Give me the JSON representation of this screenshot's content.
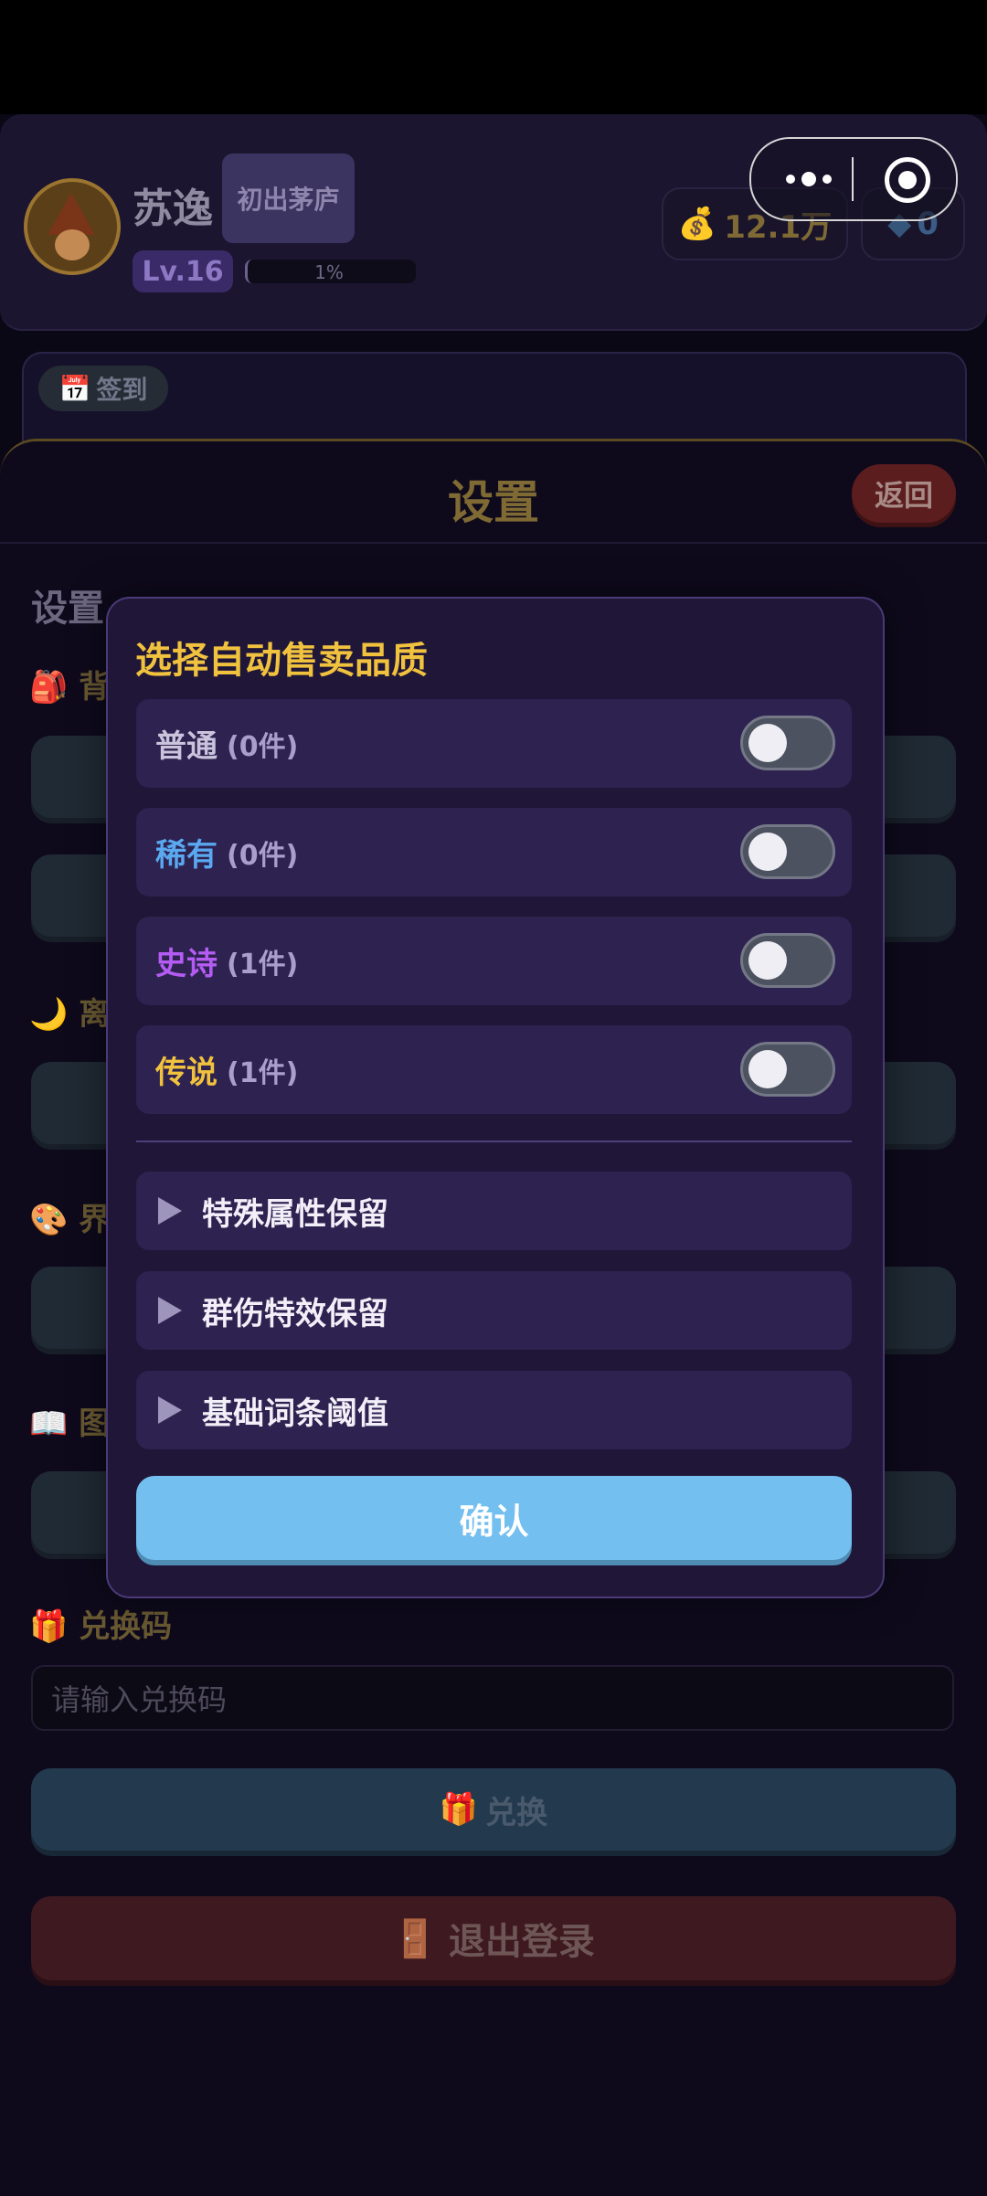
{
  "header": {
    "username": "苏逸",
    "title_badge": "初出茅庐",
    "level": "Lv.16",
    "xp_percent": "1%",
    "gold_amount": "12.1万",
    "gem_amount": "0"
  },
  "checkin": {
    "label": "签到"
  },
  "settings": {
    "sheet_title": "设置",
    "back_label": "返回",
    "section_heading": "设置",
    "sections": [
      {
        "icon": "backpack-icon",
        "label": "背包自动售卖"
      },
      {
        "icon": "moon-icon",
        "label": "离线挂机"
      },
      {
        "icon": "palette-icon",
        "label": "界面"
      },
      {
        "icon": "book-icon",
        "label": "图鉴"
      },
      {
        "icon": "gift-icon",
        "label": "兑换码"
      }
    ],
    "section_visible_fragments": [
      "背包",
      "离",
      "界",
      "图",
      "兑换码"
    ],
    "redeem_placeholder": "请输入兑换码",
    "redeem_button": "兑换",
    "logout_button": "退出登录"
  },
  "modal": {
    "title": "选择自动售卖品质",
    "qualities": [
      {
        "name": "普通",
        "count": "(0件)",
        "color": "#c9c4dc",
        "enabled": false
      },
      {
        "name": "稀有",
        "count": "(0件)",
        "color": "#5aa8f0",
        "enabled": false
      },
      {
        "name": "史诗",
        "count": "(1件)",
        "color": "#b45cf2",
        "enabled": false
      },
      {
        "name": "传说",
        "count": "(1件)",
        "color": "#f0c23e",
        "enabled": false
      }
    ],
    "expanders": [
      {
        "label": "特殊属性保留"
      },
      {
        "label": "群伤特效保留"
      },
      {
        "label": "基础词条阈值"
      }
    ],
    "confirm_label": "确认"
  },
  "colors": {
    "accent_gold": "#f0c23e",
    "confirm_blue": "#73bff0",
    "modal_bg": "#201638"
  }
}
